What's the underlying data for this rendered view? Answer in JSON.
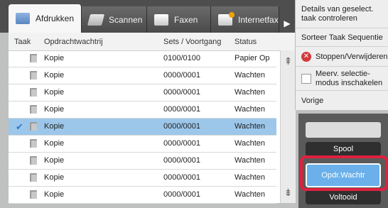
{
  "tabs": [
    {
      "label": "Afdrukken",
      "icon": "printer-icon",
      "active": true
    },
    {
      "label": "Scannen",
      "icon": "scanner-icon",
      "active": false
    },
    {
      "label": "Faxen",
      "icon": "fax-icon",
      "active": false
    },
    {
      "label": "Internetfax",
      "icon": "internet-fax-icon",
      "active": false
    }
  ],
  "table": {
    "headers": {
      "job": "Taak",
      "queue": "Opdrachtwachtrij",
      "sets": "Sets / Voortgang",
      "status": "Status"
    },
    "rows": [
      {
        "name": "Kopie",
        "sets": "0100/0100",
        "status": "Papier Op",
        "selected": false
      },
      {
        "name": "Kopie",
        "sets": "0000/0001",
        "status": "Wachten",
        "selected": false
      },
      {
        "name": "Kopie",
        "sets": "0000/0001",
        "status": "Wachten",
        "selected": false
      },
      {
        "name": "Kopie",
        "sets": "0000/0001",
        "status": "Wachten",
        "selected": false
      },
      {
        "name": "Kopie",
        "sets": "0000/0001",
        "status": "Wachten",
        "selected": true
      },
      {
        "name": "Kopie",
        "sets": "0000/0001",
        "status": "Wachten",
        "selected": false
      },
      {
        "name": "Kopie",
        "sets": "0000/0001",
        "status": "Wachten",
        "selected": false
      },
      {
        "name": "Kopie",
        "sets": "0000/0001",
        "status": "Wachten",
        "selected": false
      },
      {
        "name": "Kopie",
        "sets": "0000/0001",
        "status": "Wachten",
        "selected": false
      }
    ]
  },
  "menu": {
    "details": "Details van geselect. taak controleren",
    "sort": "Sorteer Taak Sequentie",
    "stop": "Stoppen/Verwijderen",
    "multi": "Meerv. selectie-modus inschakelen",
    "back": "Vorige"
  },
  "side": {
    "spool": "Spool",
    "queue": "Opdr.Wachtr",
    "done": "Voltooid"
  },
  "colors": {
    "highlight": "#e0203f",
    "selected_row": "#9cc7ea",
    "accent_button": "#6bb0ea"
  }
}
